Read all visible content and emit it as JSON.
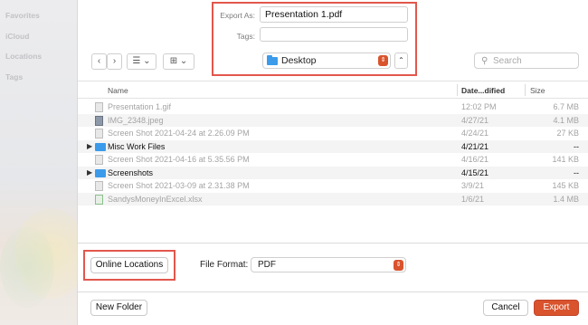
{
  "sidebar": {
    "sections": [
      "Favorites",
      "iCloud",
      "Locations",
      "Tags"
    ]
  },
  "export": {
    "export_as_label": "Export As:",
    "export_as_value": "Presentation 1.pdf",
    "tags_label": "Tags:",
    "tags_value": "",
    "location": "Desktop",
    "collapse_symbol": "⌃"
  },
  "toolbar": {
    "back_symbol": "‹",
    "forward_symbol": "›",
    "list_view_symbol": "☰",
    "grid_view_symbol": "⊞",
    "dropdown_symbol": "⌄",
    "search_placeholder": "Search"
  },
  "table": {
    "columns": {
      "name": "Name",
      "date": "Date...dified",
      "size": "Size"
    },
    "rows": [
      {
        "name": "Presentation 1.gif",
        "date": "12:02 PM",
        "size": "6.7 MB",
        "icon": "gif-file-icon",
        "kind": "file",
        "enabled": false
      },
      {
        "name": "IMG_2348.jpeg",
        "date": "4/27/21",
        "size": "4.1 MB",
        "icon": "jpeg-file-icon",
        "kind": "file",
        "enabled": false
      },
      {
        "name": "Screen Shot 2021-04-24 at 2.26.09 PM",
        "date": "4/24/21",
        "size": "27 KB",
        "icon": "screenshot-file-icon",
        "kind": "file",
        "enabled": false
      },
      {
        "name": "Misc Work Files",
        "date": "4/21/21",
        "size": "--",
        "icon": "folder-icon",
        "kind": "folder",
        "enabled": true
      },
      {
        "name": "Screen Shot 2021-04-16 at 5.35.56 PM",
        "date": "4/16/21",
        "size": "141 KB",
        "icon": "screenshot-file-icon",
        "kind": "file",
        "enabled": false
      },
      {
        "name": "Screenshots",
        "date": "4/15/21",
        "size": "--",
        "icon": "folder-icon",
        "kind": "folder",
        "enabled": true
      },
      {
        "name": "Screen Shot 2021-03-09 at 2.31.38 PM",
        "date": "3/9/21",
        "size": "145 KB",
        "icon": "screenshot-file-icon",
        "kind": "file",
        "enabled": false
      },
      {
        "name": "SandysMoneyInExcel.xlsx",
        "date": "1/6/21",
        "size": "1.4 MB",
        "icon": "xlsx-file-icon",
        "kind": "file",
        "enabled": false
      }
    ]
  },
  "options": {
    "online_locations_label": "Online Locations",
    "file_format_label": "File Format:",
    "file_format_value": "PDF"
  },
  "footer": {
    "new_folder_label": "New Folder",
    "cancel_label": "Cancel",
    "export_label": "Export"
  },
  "colors": {
    "accent": "#d9532d",
    "highlight_box": "#e2574c",
    "folder_blue": "#3b9bea"
  }
}
